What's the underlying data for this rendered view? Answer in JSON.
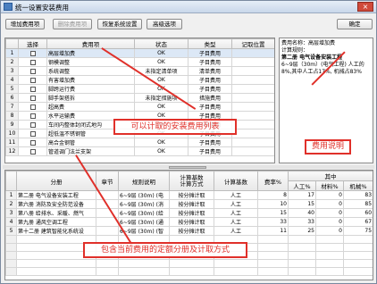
{
  "window": {
    "title": "统一设置安装费用",
    "close_glyph": "×"
  },
  "toolbar": {
    "add": "增加费用项",
    "delete": "删除费用项",
    "restore": "恢复系统设置",
    "advanced": "高级选项",
    "ok": "确定"
  },
  "fee_table": {
    "headers": [
      "",
      "选择",
      "费用项",
      "状态",
      "类型",
      "记取位置"
    ],
    "rows": [
      {
        "n": "1",
        "name": "高层增加费",
        "status": "OK",
        "type": "子目费用"
      },
      {
        "n": "2",
        "name": "钢模调整",
        "status": "OK",
        "type": "子目费用"
      },
      {
        "n": "3",
        "name": "系统调整",
        "status": "未指定清单项",
        "type": "清单费用"
      },
      {
        "n": "4",
        "name": "有害增加费",
        "status": "OK",
        "type": "子目费用"
      },
      {
        "n": "5",
        "name": "脚跨运行费",
        "status": "OK",
        "type": "子目费用"
      },
      {
        "n": "6",
        "name": "脚手架搭拆",
        "status": "未指定措施项",
        "type": "措施费用"
      },
      {
        "n": "7",
        "name": "超高费",
        "status": "OK",
        "type": "子目费用"
      },
      {
        "n": "8",
        "name": "水平运输费",
        "status": "OK",
        "type": "子目费用"
      },
      {
        "n": "9",
        "name": "车间内整体封闭式地沟",
        "status": "OK",
        "type": "子目费用"
      },
      {
        "n": "10",
        "name": "超低温不锈钢管",
        "status": "OK",
        "type": "子目费用"
      },
      {
        "n": "11",
        "name": "高合金钢管",
        "status": "OK",
        "type": "子目费用"
      },
      {
        "n": "12",
        "name": "管道调门法兰支架",
        "status": "OK",
        "type": "子目费用"
      }
    ]
  },
  "info_panel": {
    "name_label": "费用名称：高层增加费",
    "rule_label": "计算规则：",
    "chapter": "第二册 电气设备安装工程",
    "rule_text": "6~9层（30m）(电气工程) 人工的8%,其中人工占17%, 机械占83%"
  },
  "detail_table": {
    "headers": {
      "division": "分册",
      "chapter": "章节",
      "rule": "规则说明",
      "base": "计算基数\n计算方式",
      "basis": "计算基数",
      "rate": "费率%",
      "of_which": "其中",
      "labor": "人工%",
      "material": "材料%",
      "machine": "机械%"
    },
    "rows": [
      {
        "n": "1",
        "division": "第二册 电气设备安装工程",
        "rule": "6~9层 (30m) (电",
        "method": "按分摊计取",
        "basis": "人工",
        "rate": "8",
        "labor": "17",
        "material": "0",
        "machine": "83"
      },
      {
        "n": "2",
        "division": "第六册 消防及安全防范设备",
        "rule": "6~9层 (30m) (消",
        "method": "按分摊计取",
        "basis": "人工",
        "rate": "10",
        "labor": "15",
        "material": "0",
        "machine": "85"
      },
      {
        "n": "3",
        "division": "第八册 给排水、采暖、燃气",
        "rule": "6~9层 (30m) (给",
        "method": "按分摊计取",
        "basis": "人工",
        "rate": "15",
        "labor": "40",
        "material": "0",
        "machine": "60"
      },
      {
        "n": "4",
        "division": "第九册 通风空调工程",
        "rule": "6~9层 (30m) (通",
        "method": "按分摊计取",
        "basis": "人工",
        "rate": "33",
        "labor": "33",
        "material": "0",
        "machine": "67"
      },
      {
        "n": "5",
        "division": "第十二册 建筑智能化系统设",
        "rule": "6~9层 (30m) (智",
        "method": "按分摊计取",
        "basis": "人工",
        "rate": "11",
        "labor": "25",
        "material": "0",
        "machine": "75"
      }
    ]
  },
  "annotations": {
    "fee_list": "可以计取的安装费用列表",
    "fee_desc": "费用说明",
    "detail": "包含当前费用的定额分册及计取方式"
  },
  "colors": {
    "annotation": "#e0302a",
    "title_bar": "#c9d7ea"
  }
}
